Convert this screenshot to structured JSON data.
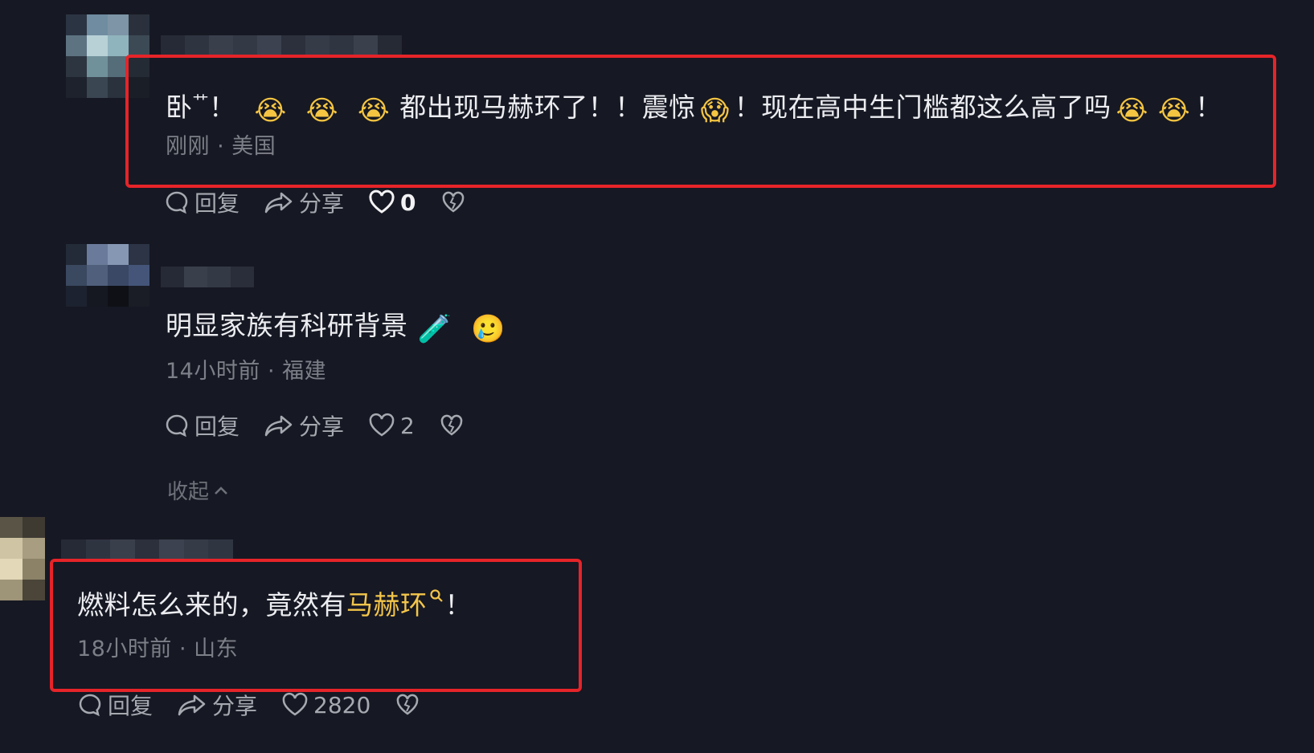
{
  "comments": [
    {
      "text_parts": [
        "卧",
        "艹",
        "！",
        "😭",
        "😭",
        "😭",
        "都出现马赫环了！！震惊",
        "😱",
        "！现在高中生门槛都这么高了吗",
        "😭",
        "😭",
        "！"
      ],
      "time": "刚刚",
      "location": "美国",
      "reply_label": "回复",
      "share_label": "分享",
      "likes": "0"
    },
    {
      "text": "明显家族有科研背景",
      "emojis": [
        "🧪",
        "🥲"
      ],
      "time": "14小时前",
      "location": "福建",
      "reply_label": "回复",
      "share_label": "分享",
      "likes": "2",
      "collapse_label": "收起"
    },
    {
      "text_before": "燃料怎么来的，竟然有",
      "highlight": "马赫环",
      "text_after": "！",
      "time": "18小时前",
      "location": "山东",
      "reply_label": "回复",
      "share_label": "分享",
      "likes": "2820"
    }
  ],
  "separator": "·",
  "icons": [
    "comment-bubble-icon",
    "share-arrow-icon",
    "heart-icon",
    "dislike-heart-icon",
    "search-icon",
    "chevron-up-icon"
  ],
  "colors": {
    "background": "#161823",
    "highlight": "#f3c54a",
    "annotation_box": "#e62429",
    "meta": "#7d7f88"
  }
}
